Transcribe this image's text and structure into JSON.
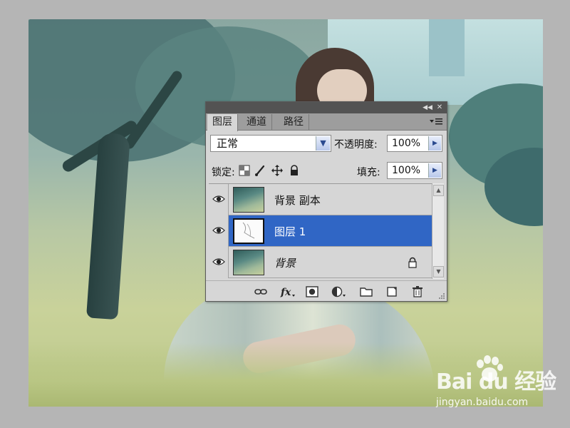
{
  "panel": {
    "tabs": [
      {
        "label": "图层",
        "active": true
      },
      {
        "label": "通道",
        "active": false
      },
      {
        "label": "路径",
        "active": false
      }
    ],
    "blend_mode": "正常",
    "opacity_label": "不透明度:",
    "opacity_value": "100%",
    "lock_label": "锁定:",
    "fill_label": "填充:",
    "fill_value": "100%",
    "layers": [
      {
        "name": "背景 副本",
        "visible": true,
        "selected": false,
        "locked": false
      },
      {
        "name": "图层 1",
        "visible": true,
        "selected": true,
        "locked": false
      },
      {
        "name": "背景",
        "visible": true,
        "selected": false,
        "locked": true
      }
    ],
    "selected_color": "#3066c5"
  },
  "watermark": {
    "logo": "Bai du 经验",
    "url": "jingyan.baidu.com"
  }
}
